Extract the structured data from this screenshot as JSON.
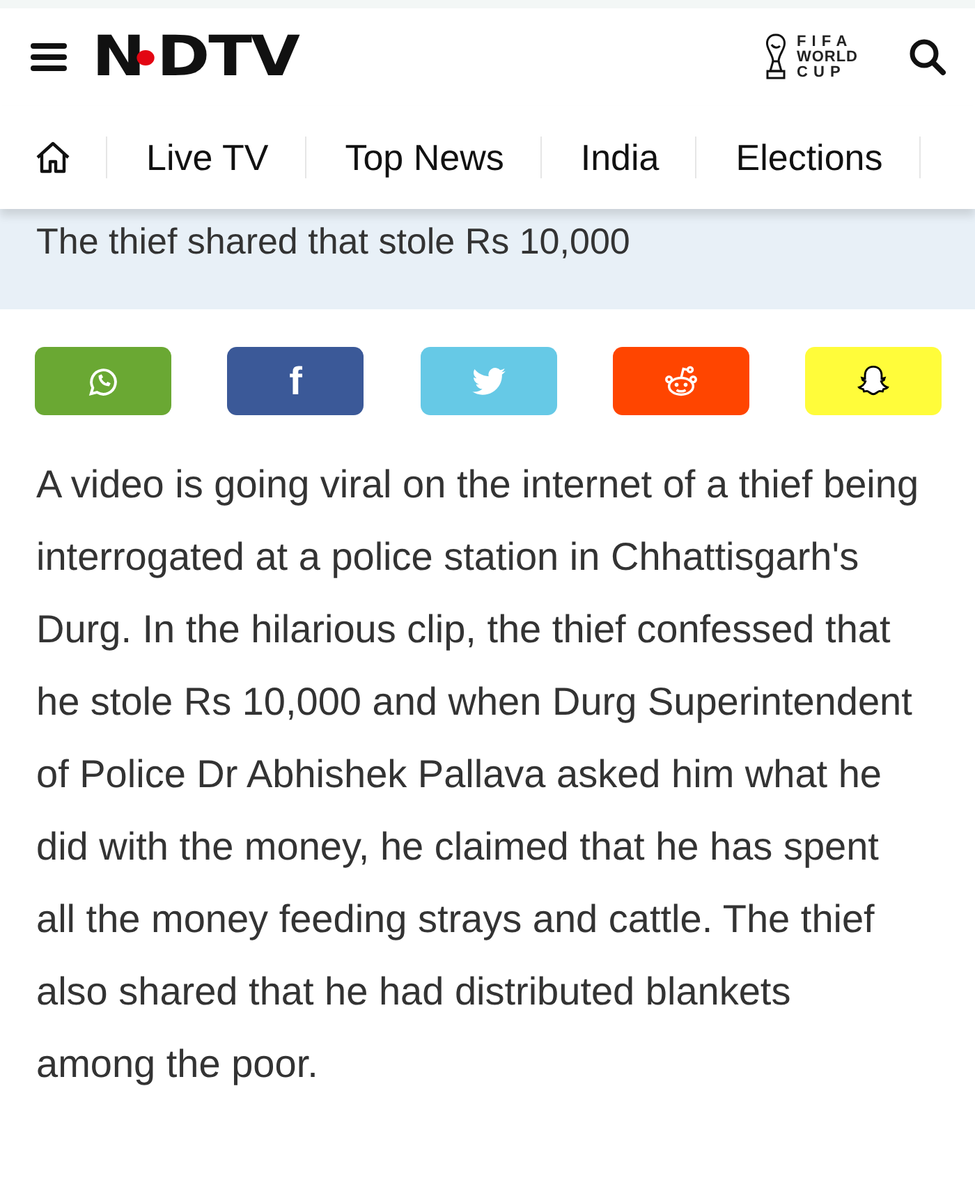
{
  "header": {
    "logo": {
      "before_dot": "N",
      "after_dot": "DTV"
    },
    "badge_lines": [
      "F I F A",
      "WORLD",
      "C U P"
    ]
  },
  "nav": {
    "items": [
      "Live TV",
      "Top News",
      "India",
      "Elections"
    ]
  },
  "headline": "The thief shared that stole Rs 10,000",
  "share_buttons": [
    {
      "kind": "whatsapp",
      "color": "#6aa833"
    },
    {
      "kind": "facebook",
      "color": "#3b5998",
      "label": "f"
    },
    {
      "kind": "twitter",
      "color": "#66c9e6"
    },
    {
      "kind": "reddit",
      "color": "#ff4500"
    },
    {
      "kind": "snapchat",
      "color": "#fffc3a"
    }
  ],
  "article": {
    "paragraph": "A video is going viral on the internet of a thief being interrogated at a police station in Chhattisgarh's Durg. In the hilarious clip, the thief confessed that he stole Rs 10,000 and when Durg Superintendent of Police Dr Abhishek Pallava asked him what he did with the money, he claimed that he has spent all the money feeding strays and cattle. The thief also shared that he had distributed blankets among the poor."
  }
}
